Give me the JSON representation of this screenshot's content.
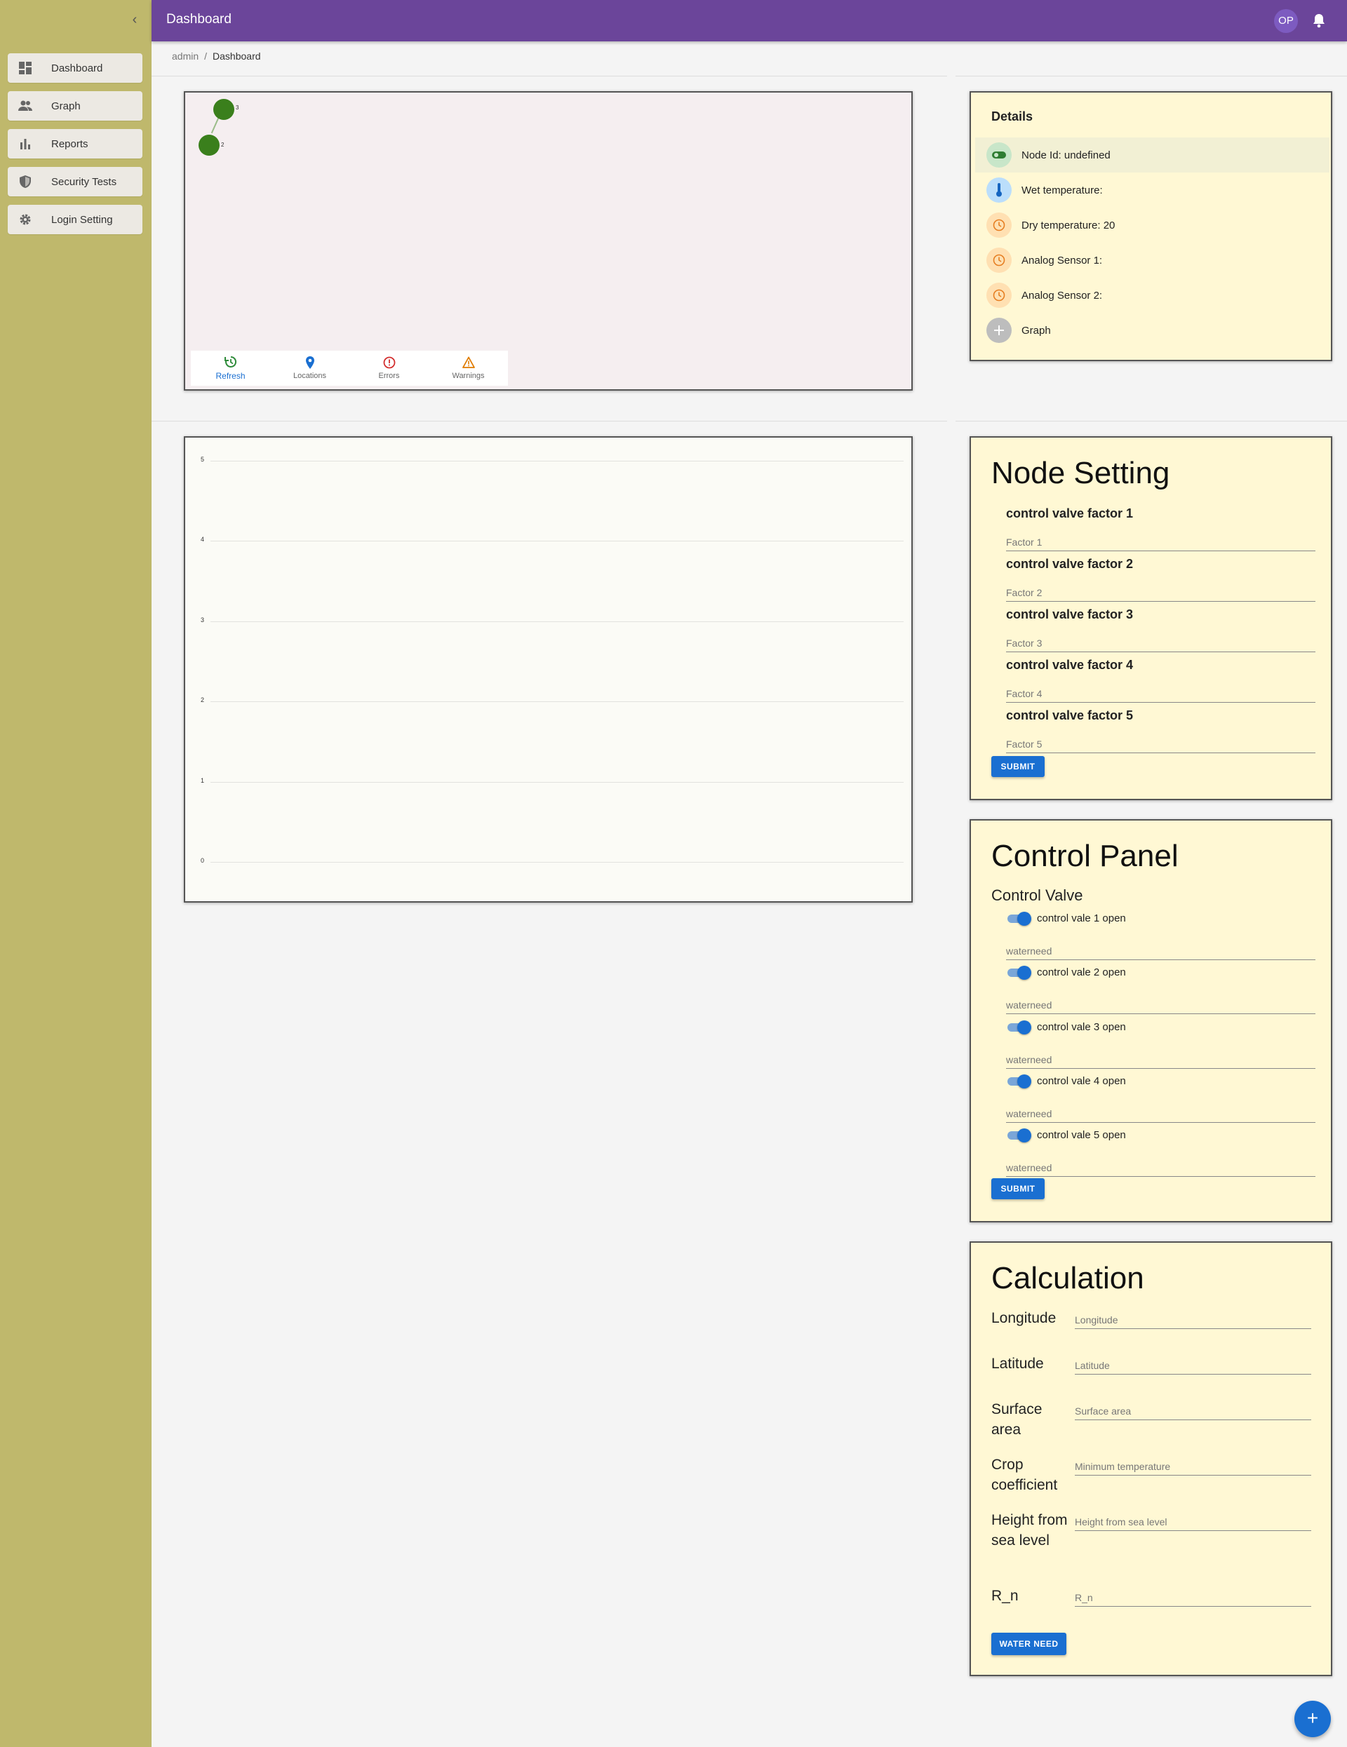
{
  "app": {
    "title": "Dashboard"
  },
  "header": {
    "avatar_initials": "OP"
  },
  "sidebar": {
    "items": [
      {
        "label": "Dashboard",
        "icon": "dashboard-icon"
      },
      {
        "label": "Graph",
        "icon": "people-icon"
      },
      {
        "label": "Reports",
        "icon": "bar-chart-icon"
      },
      {
        "label": "Security Tests",
        "icon": "shield-icon"
      },
      {
        "label": "Login Setting",
        "icon": "gear-icon"
      }
    ]
  },
  "breadcrumb": {
    "root": "admin",
    "separator": "/",
    "current": "Dashboard"
  },
  "map": {
    "nodes": [
      {
        "label": "3"
      },
      {
        "label": "2"
      }
    ],
    "bottom_nav": [
      {
        "label": "Refresh",
        "icon": "refresh-icon",
        "color": "#2e8b3a",
        "active": true
      },
      {
        "label": "Locations",
        "icon": "location-pin-icon",
        "color": "#1a6fd1",
        "active": false
      },
      {
        "label": "Errors",
        "icon": "error-icon",
        "color": "#d32f2f",
        "active": false
      },
      {
        "label": "Warnings",
        "icon": "warning-icon",
        "color": "#e07b00",
        "active": false
      }
    ]
  },
  "chart_data": {
    "type": "line",
    "series": [],
    "yticks": [
      "5",
      "4",
      "3",
      "2",
      "1",
      "0"
    ],
    "ylim": [
      0,
      5
    ],
    "grid": true
  },
  "details": {
    "title": "Details",
    "rows": [
      {
        "text": "Node Id: undefined",
        "icon": "toggle-icon"
      },
      {
        "text": "Wet temperature:",
        "icon": "thermometer-icon"
      },
      {
        "text": "Dry temperature: 20",
        "icon": "clock-icon"
      },
      {
        "text": "Analog Sensor 1:",
        "icon": "clock-icon"
      },
      {
        "text": "Analog Sensor 2:",
        "icon": "clock-icon"
      },
      {
        "text": "Graph",
        "icon": "plus-icon"
      }
    ]
  },
  "node_setting": {
    "title": "Node Setting",
    "factors": [
      {
        "title": "control valve factor 1",
        "placeholder": "Factor 1"
      },
      {
        "title": "control valve factor 2",
        "placeholder": "Factor 2"
      },
      {
        "title": "control valve factor 3",
        "placeholder": "Factor 3"
      },
      {
        "title": "control valve factor 4",
        "placeholder": "Factor 4"
      },
      {
        "title": "control valve factor 5",
        "placeholder": "Factor 5"
      }
    ],
    "submit_label": "SUBMIT"
  },
  "control_panel": {
    "title": "Control Panel",
    "subtitle": "Control Valve",
    "valves": [
      {
        "label": "control vale 1 open",
        "placeholder": "waterneed"
      },
      {
        "label": "control vale 2 open",
        "placeholder": "waterneed"
      },
      {
        "label": "control vale 3 open",
        "placeholder": "waterneed"
      },
      {
        "label": "control vale 4 open",
        "placeholder": "waterneed"
      },
      {
        "label": "control vale 5 open",
        "placeholder": "waterneed"
      }
    ],
    "submit_label": "SUBMIT"
  },
  "calculation": {
    "title": "Calculation",
    "fields": [
      {
        "label": "Longitude",
        "placeholder": "Longitude"
      },
      {
        "label": "Latitude",
        "placeholder": "Latitude"
      },
      {
        "label": "Surface area",
        "placeholder": "Surface area"
      },
      {
        "label": "Crop coefficient",
        "placeholder": "Minimum temperature"
      },
      {
        "label": "Height from sea level",
        "placeholder": "Height from sea level"
      },
      {
        "label": "R_n",
        "placeholder": "R_n"
      }
    ],
    "button_label": "WATER NEED"
  },
  "fab": {
    "label": "+"
  }
}
